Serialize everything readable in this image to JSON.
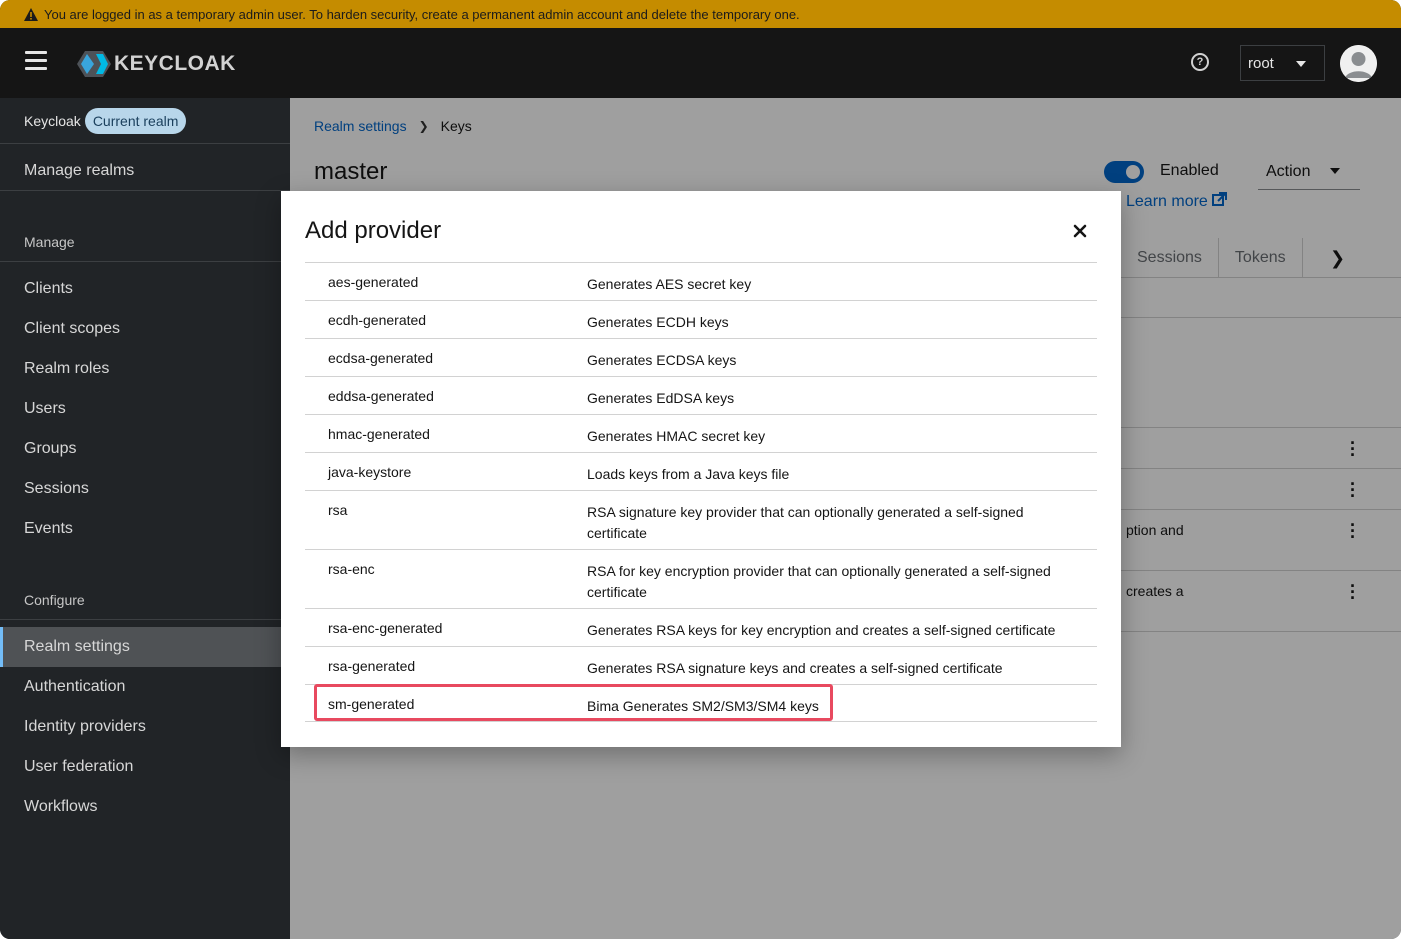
{
  "banner": {
    "text": "You are logged in as a temporary admin user. To harden security, create a permanent admin account and delete the temporary one."
  },
  "masthead": {
    "logo_text": "KEYCLOAK",
    "user": "root",
    "help_glyph": "?"
  },
  "sidebar": {
    "realm_name": "Keycloak",
    "realm_badge": "Current realm",
    "manage_realms": "Manage realms",
    "sections": {
      "manage": "Manage",
      "configure": "Configure"
    },
    "manage_items": [
      "Clients",
      "Client scopes",
      "Realm roles",
      "Users",
      "Groups",
      "Sessions",
      "Events"
    ],
    "configure_items": [
      "Realm settings",
      "Authentication",
      "Identity providers",
      "User federation",
      "Workflows"
    ],
    "active_item": "Realm settings"
  },
  "page": {
    "breadcrumb": {
      "parent": "Realm settings",
      "current": "Keys"
    },
    "title": "master",
    "enabled_label": "Enabled",
    "action_label": "Action",
    "learn_more": "Learn more",
    "tabs": [
      "Sessions",
      "Tokens"
    ],
    "partial_texts": [
      "ption and",
      "creates a"
    ]
  },
  "modal": {
    "title": "Add provider",
    "providers": [
      {
        "name": "aes-generated",
        "description": "Generates AES secret key"
      },
      {
        "name": "ecdh-generated",
        "description": "Generates ECDH keys"
      },
      {
        "name": "ecdsa-generated",
        "description": "Generates ECDSA keys"
      },
      {
        "name": "eddsa-generated",
        "description": "Generates EdDSA keys"
      },
      {
        "name": "hmac-generated",
        "description": "Generates HMAC secret key"
      },
      {
        "name": "java-keystore",
        "description": "Loads keys from a Java keys file"
      },
      {
        "name": "rsa",
        "description": "RSA signature key provider that can optionally generated a self-signed certificate"
      },
      {
        "name": "rsa-enc",
        "description": "RSA for key encryption provider that can optionally generated a self-signed certificate"
      },
      {
        "name": "rsa-enc-generated",
        "description": "Generates RSA keys for key encryption and creates a self-signed certificate"
      },
      {
        "name": "rsa-generated",
        "description": "Generates RSA signature keys and creates a self-signed certificate"
      },
      {
        "name": "sm-generated",
        "description": "Bima Generates SM2/SM3/SM4 keys"
      }
    ]
  },
  "colors": {
    "banner": "#c58c00",
    "link": "#0066cc",
    "highlight": "#e8495f",
    "sidebar": "#212427"
  }
}
